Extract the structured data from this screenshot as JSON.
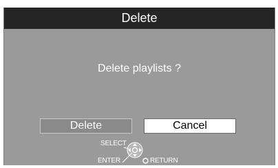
{
  "dialog": {
    "title": "Delete",
    "message": "Delete playlists ?"
  },
  "buttons": {
    "delete_label": "Delete",
    "cancel_label": "Cancel",
    "focused": "delete"
  },
  "hints": {
    "select_label": "SELECT",
    "enter_label": "ENTER",
    "return_label": "RETURN",
    "dpad_icon": "dpad-icon",
    "return_icon": "return-button-icon"
  },
  "colors": {
    "panel_bg": "#9a9a9a",
    "title_bg": "#262626",
    "focused_button_bg": "#8a8a8a",
    "unfocused_button_bg": "#ffffff"
  }
}
